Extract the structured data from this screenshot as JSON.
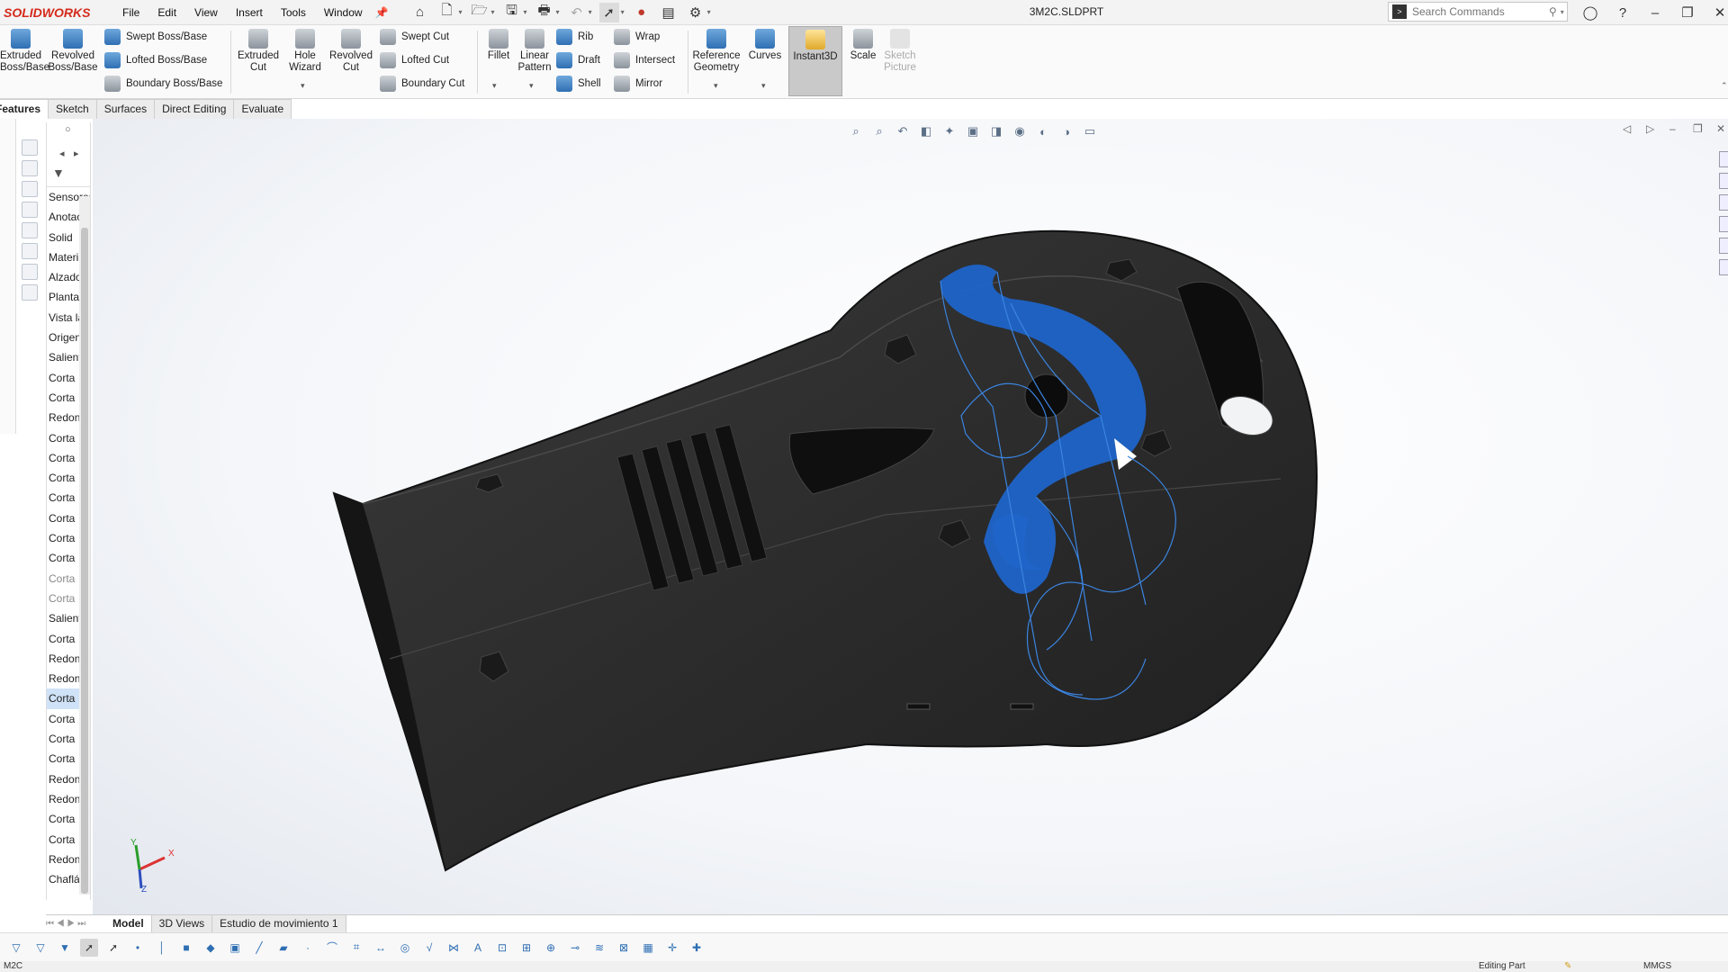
{
  "app": {
    "name": "SOLIDWORKS",
    "document_title": "3M2C.SLDPRT"
  },
  "menu": [
    "File",
    "Edit",
    "View",
    "Insert",
    "Tools",
    "Window"
  ],
  "search": {
    "placeholder": "Search Commands"
  },
  "ribbon": {
    "extruded_boss": "Extruded Boss/Base",
    "revolved_boss": "Revolved Boss/Base",
    "swept_boss": "Swept Boss/Base",
    "lofted_boss": "Lofted Boss/Base",
    "boundary_boss": "Boundary Boss/Base",
    "extruded_cut": "Extruded Cut",
    "hole_wizard": "Hole Wizard",
    "revolved_cut": "Revolved Cut",
    "swept_cut": "Swept Cut",
    "lofted_cut": "Lofted Cut",
    "boundary_cut": "Boundary Cut",
    "fillet": "Fillet",
    "linear_pattern": "Linear Pattern",
    "rib": "Rib",
    "draft": "Draft",
    "shell": "Shell",
    "wrap": "Wrap",
    "intersect": "Intersect",
    "mirror": "Mirror",
    "reference_geometry": "Reference Geometry",
    "curves": "Curves",
    "instant3d": "Instant3D",
    "scale": "Scale",
    "sketch_picture": "Sketch Picture"
  },
  "tabs": [
    "Features",
    "Sketch",
    "Surfaces",
    "Direct Editing",
    "Evaluate"
  ],
  "tree": {
    "items": [
      "Sensores",
      "Anotaciones",
      "Solid",
      "Material",
      "Alzado",
      "Planta",
      "Vista lateral",
      "Origen",
      "Saliente",
      "Corta",
      "Corta",
      "Redondeo",
      "Corta",
      "Corta",
      "Corta",
      "Corta",
      "Corta",
      "Corta",
      "Corta",
      "Corta",
      "Corta",
      "Saliente",
      "Corta",
      "Redondeo",
      "Redondeo",
      "Corta",
      "Corta",
      "Corta",
      "Corta",
      "Redondeo",
      "Redondeo",
      "Corta",
      "Corta",
      "Redondeo",
      "Chaflán"
    ]
  },
  "bottom_tabs": [
    "Model",
    "3D Views",
    "Estudio de movimiento 1"
  ],
  "status": {
    "left": "M2C",
    "mode": "Editing Part",
    "units": "MMGS"
  },
  "colors": {
    "selection_blue": "#1f64c8",
    "part_black": "#2a2a2a",
    "accent_red": "#d42a1c"
  },
  "triad_labels": {
    "x": "X",
    "y": "Y",
    "z": "Z"
  }
}
